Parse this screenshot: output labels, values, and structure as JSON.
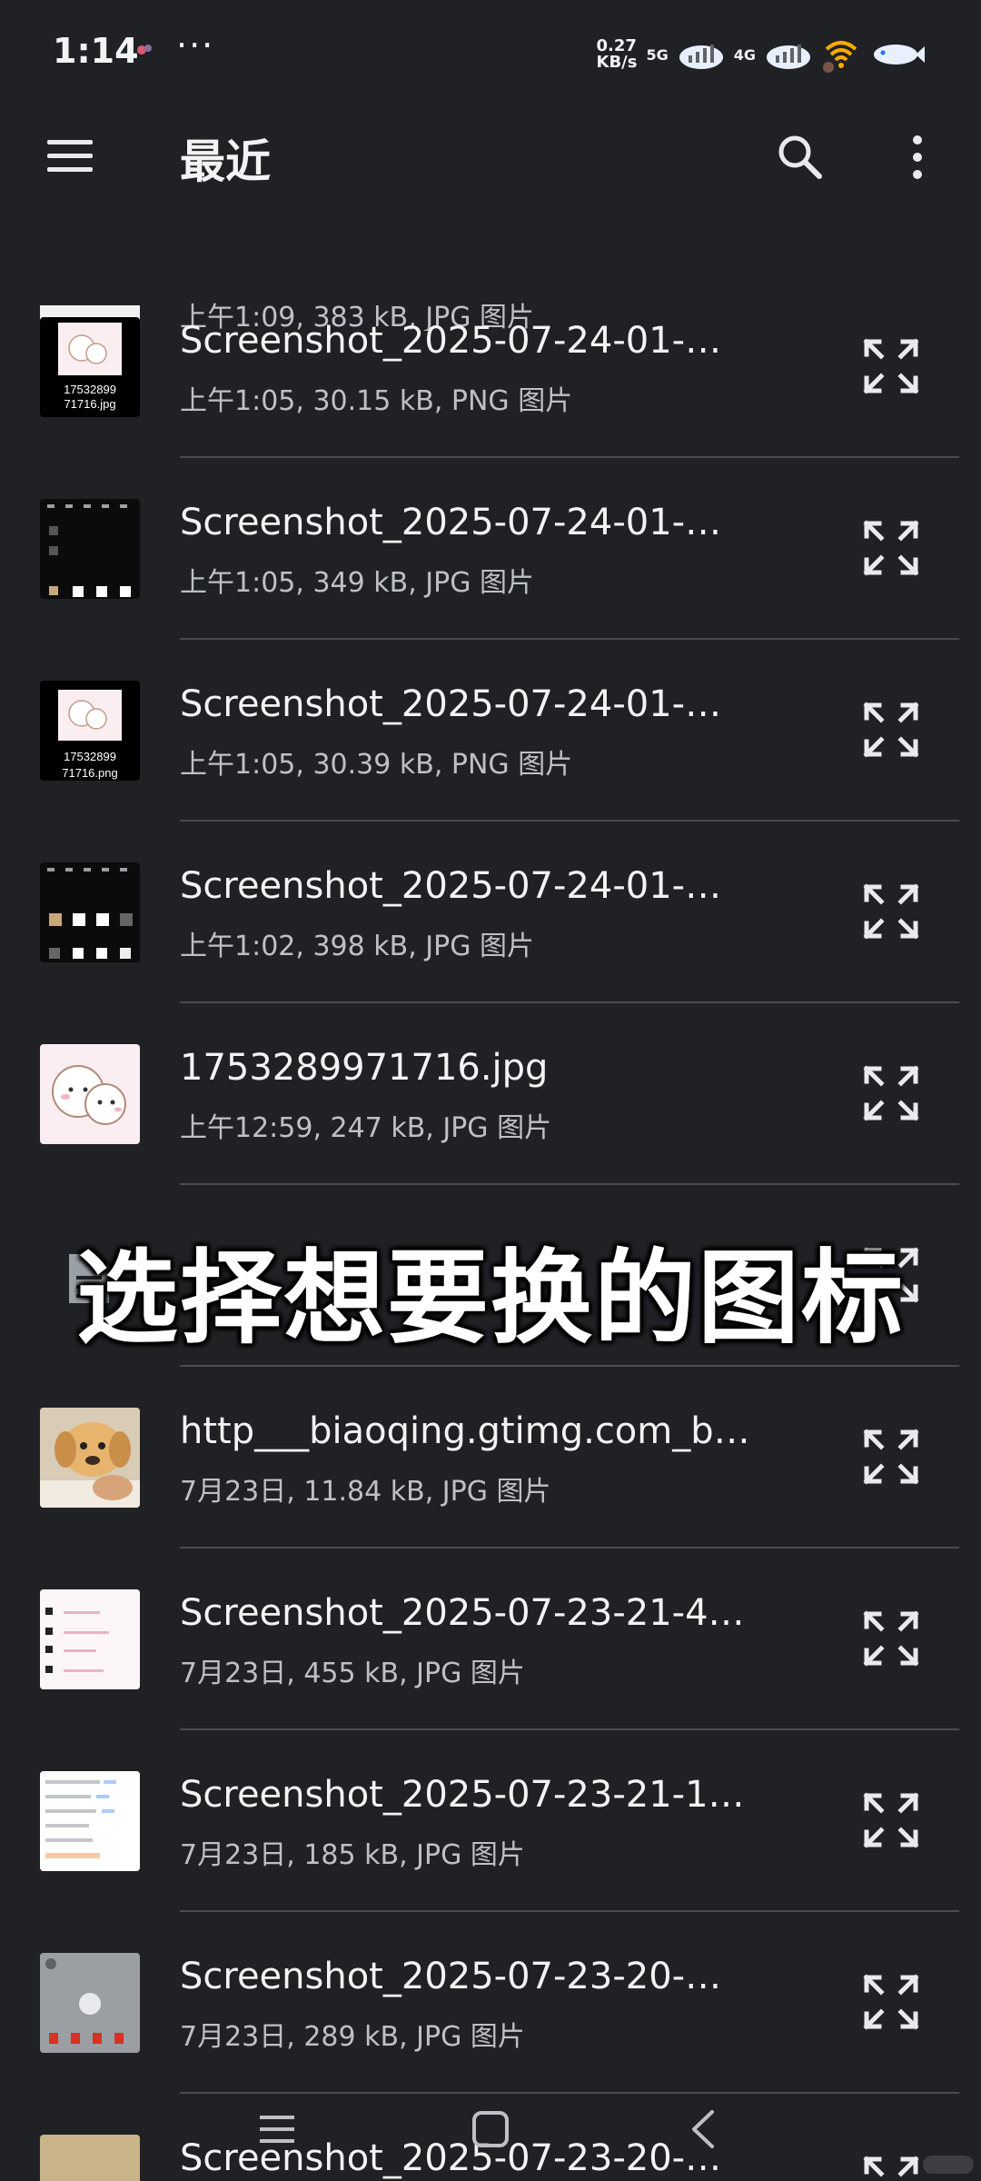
{
  "status_bar": {
    "time": "1:14",
    "overflow": "···",
    "net_speed": "0.27",
    "net_speed_unit": "KB/s",
    "signal_1": "5G",
    "signal_2": "4G"
  },
  "app_bar": {
    "title": "最近"
  },
  "top_partial": {
    "meta": "上午1:09, 383 kB, JPG 图片"
  },
  "files": [
    {
      "name": "Screenshot_2025-07-24-01-…",
      "meta": "上午1:05, 30.15 kB, PNG 图片",
      "thumb_label": "17532899\n71716.jpg"
    },
    {
      "name": "Screenshot_2025-07-24-01-…",
      "meta": "上午1:05, 349 kB, JPG 图片"
    },
    {
      "name": "Screenshot_2025-07-24-01-…",
      "meta": "上午1:05, 30.39 kB, PNG 图片",
      "thumb_label": "17532899\n71716.png"
    },
    {
      "name": "Screenshot_2025-07-24-01-…",
      "meta": "上午1:02, 398 kB, JPG 图片"
    },
    {
      "name": "1753289971716.jpg",
      "meta": "上午12:59, 247 kB, JPG 图片"
    },
    {
      "name": "",
      "meta": ""
    },
    {
      "name": "http___biaoqing.gtimg.com_b…",
      "meta": "7月23日, 11.84 kB, JPG 图片"
    },
    {
      "name": "Screenshot_2025-07-23-21-4…",
      "meta": "7月23日, 455 kB, JPG 图片"
    },
    {
      "name": "Screenshot_2025-07-23-21-1…",
      "meta": "7月23日, 185 kB, JPG 图片"
    },
    {
      "name": "Screenshot_2025-07-23-20-…",
      "meta": "7月23日, 289 kB, JPG 图片"
    },
    {
      "name": "Screenshot_2025-07-23-20-…",
      "meta": ""
    }
  ],
  "overlay_caption": "选择想要换的图标",
  "colors": {
    "background": "#202124",
    "text_primary": "#f1f3f4",
    "text_secondary": "#bdc1c6",
    "divider": "#4a4c50"
  }
}
